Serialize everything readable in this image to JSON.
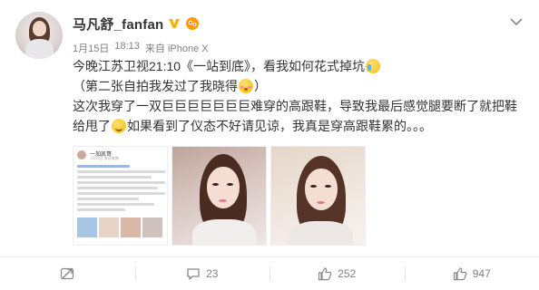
{
  "post": {
    "author": {
      "name": "马凡舒_fanfan",
      "verified_icon": "verified-v-badge-icon",
      "member_icon": "weibo-member-icon"
    },
    "meta": {
      "date": "1月15日",
      "time": "18:13",
      "source": "来自 iPhone X"
    },
    "text_lines": [
      "今晚江苏卫视21:10《一站到底》，看我如何花式掉坑",
      "（第二张自拍我发过了我晓得",
      "这次我穿了一双巨巨巨巨巨巨巨难穿的高跟鞋，导致我最后感觉腿要断了就把鞋",
      "给甩了",
      "如果看到了仪态不好请见谅，我真是穿高跟鞋累的。。。"
    ],
    "text_tail": "）",
    "screenshot_thumb": {
      "name": "一加凯哥",
      "meta": "1月15日 来自微博"
    },
    "images_count": 3
  },
  "actions": {
    "repost_icon": "repost-icon",
    "comment_icon": "comment-icon",
    "comment_count": "23",
    "like_icon": "thumbs-up-icon",
    "like_count": "252",
    "share_icon": "share-icon",
    "share_count": "947"
  },
  "colors": {
    "text": "#333333",
    "meta": "#808080",
    "verified": "#f7b500",
    "member": "#f08c00",
    "divider": "#eaeaea"
  }
}
